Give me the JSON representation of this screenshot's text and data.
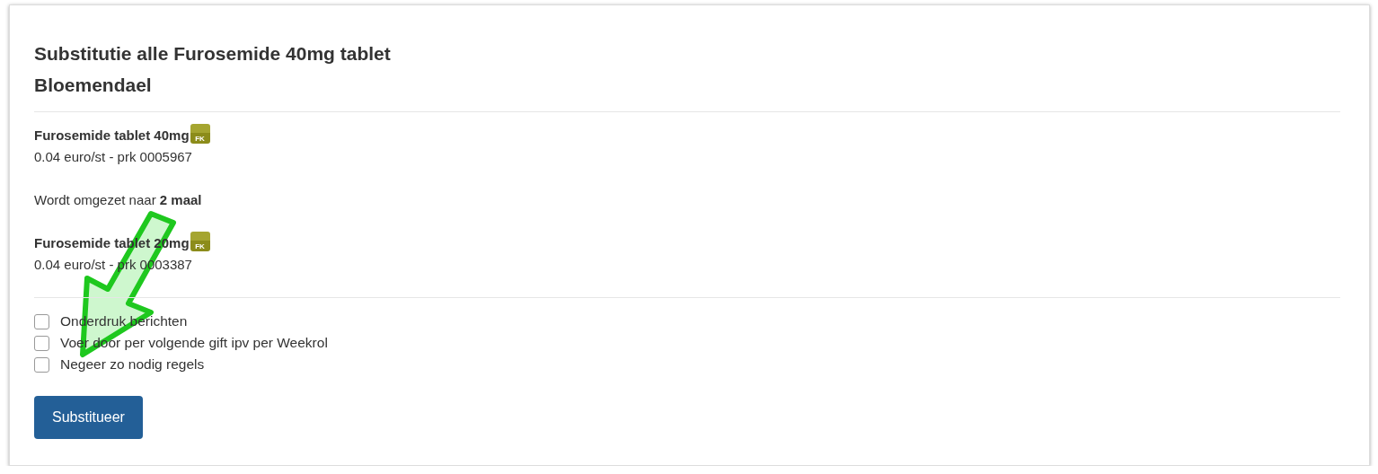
{
  "title_lines": [
    "Substitutie alle Furosemide 40mg tablet",
    "Bloemendael"
  ],
  "from_product": {
    "name": "Furosemide tablet 40mg",
    "badge": "FK",
    "price": "0.04 euro/st - prk 0005967"
  },
  "conversion": "Wordt omgezet naar **2 maal**",
  "to_product": {
    "name": "Furosemide tablet 20mg",
    "badge": "FK",
    "price": "0.04 euro/st - prk 0003387"
  },
  "options": [
    {
      "label": "Onderdruk berichten",
      "checked": false
    },
    {
      "label": "Voer door per volgende gift ipv per Weekrol",
      "checked": false
    },
    {
      "label": "Negeer zo nodig regels",
      "checked": false
    }
  ],
  "button": "Substitueer"
}
